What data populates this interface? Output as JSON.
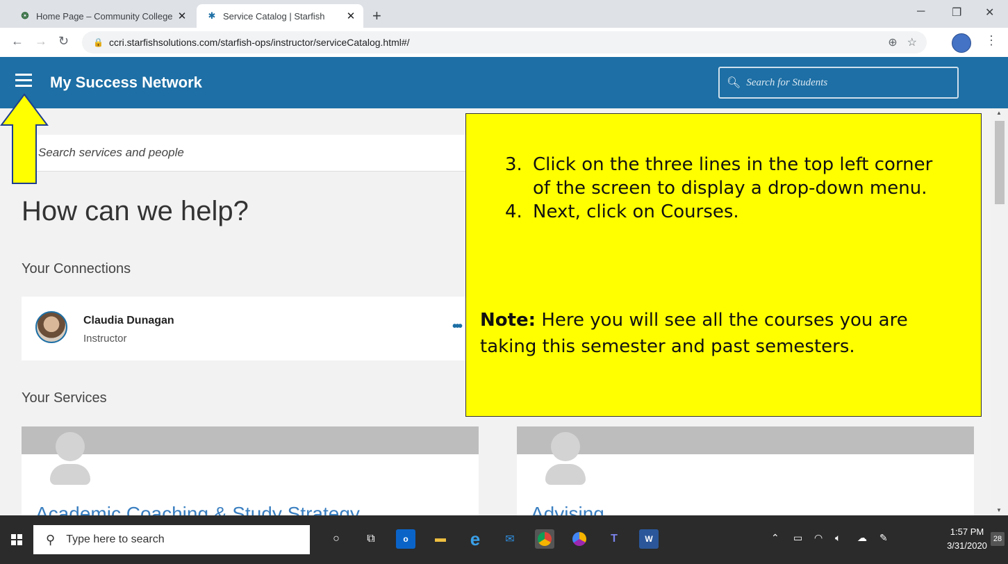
{
  "browser": {
    "tabs": [
      {
        "title": "Home Page – Community College",
        "icon": "ccri-logo-icon",
        "active": false
      },
      {
        "title": "Service Catalog | Starfish",
        "icon": "starfish-icon",
        "active": true
      }
    ],
    "url": "ccri.starfishsolutions.com/starfish-ops/instructor/serviceCatalog.html#/"
  },
  "header": {
    "title": "My Success Network",
    "search_placeholder": "Search for Students"
  },
  "main": {
    "search_placeholder": "Search services and people",
    "heading": "How can we help?",
    "connections_label": "Your Connections",
    "connection": {
      "name": "Claudia Dunagan",
      "role": "Instructor"
    },
    "services_label": "Your Services",
    "services": [
      {
        "title": "Academic Coaching & Study Strategy"
      },
      {
        "title": "Advising"
      }
    ]
  },
  "callout": {
    "steps": [
      {
        "num": "3.",
        "text": "Click on the three lines in the top left corner of the screen to display a drop-down menu."
      },
      {
        "num": "4.",
        "text": "Next, click on Courses."
      }
    ],
    "note_label": "Note:",
    "note_text": " Here you will see all the courses you are taking this semester and past semesters."
  },
  "taskbar": {
    "search_placeholder": "Type here to search",
    "time": "1:57 PM",
    "date": "3/31/2020",
    "notifications": "28"
  },
  "colors": {
    "brand": "#1d6fa5",
    "callout": "#ffff00",
    "link": "#3a7fc1"
  }
}
